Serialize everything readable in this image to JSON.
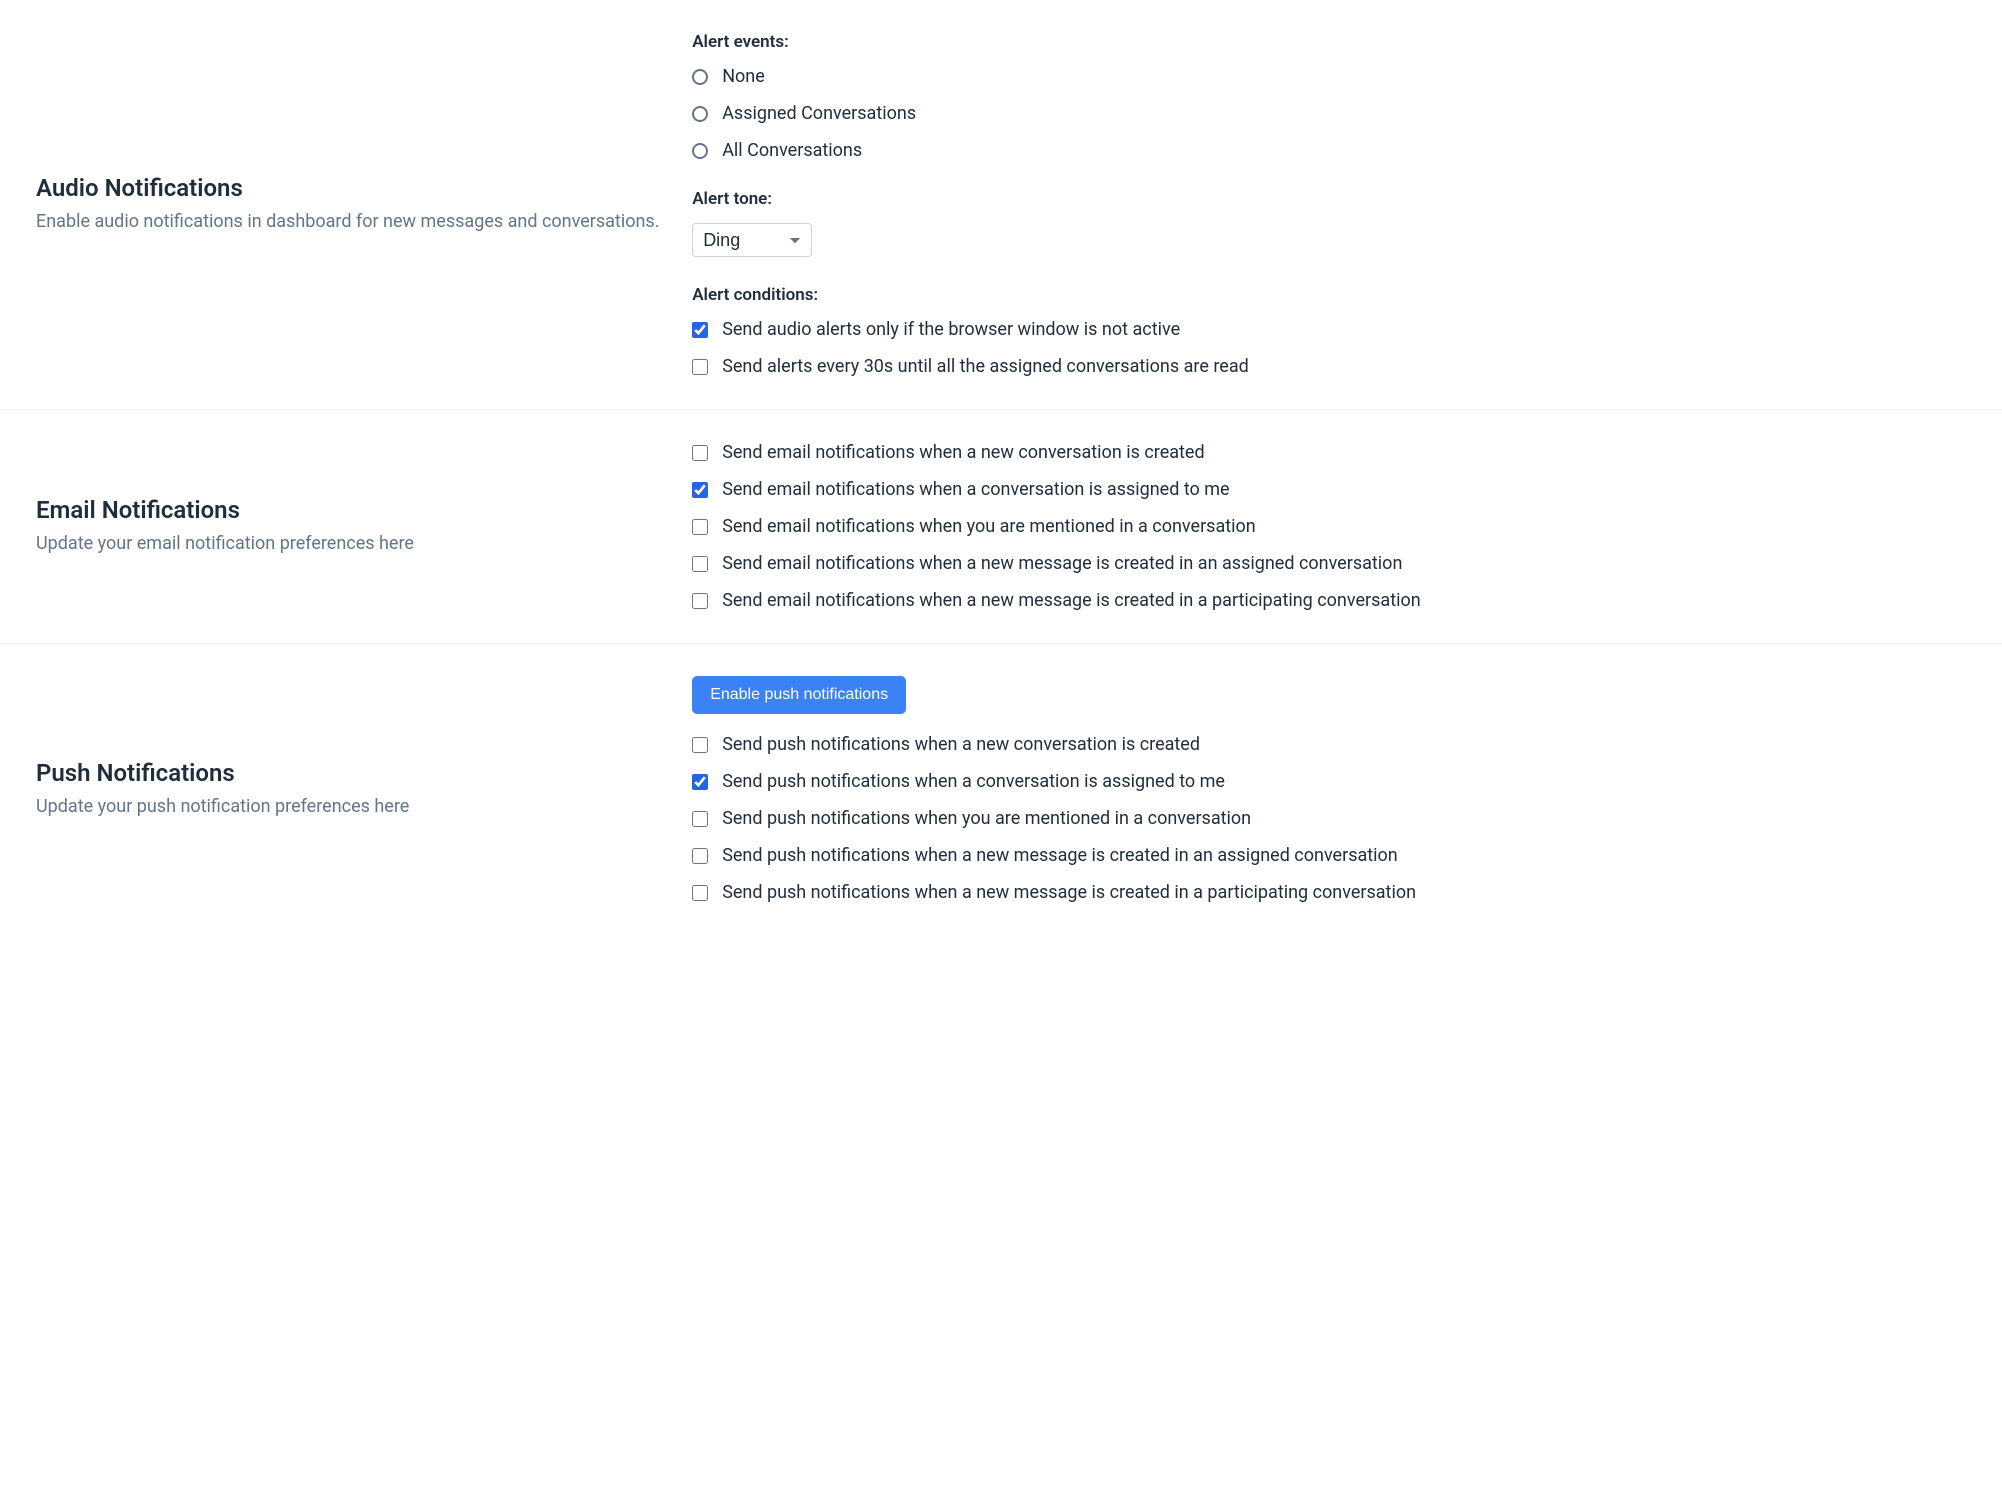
{
  "audio": {
    "title": "Audio Notifications",
    "desc": "Enable audio notifications in dashboard for new messages and conversations.",
    "events_label": "Alert events:",
    "events": {
      "none": "None",
      "assigned": "Assigned Conversations",
      "all": "All Conversations"
    },
    "tone_label": "Alert tone:",
    "tone_selected": "Ding",
    "conditions_label": "Alert conditions:",
    "conditions": {
      "inactive_only": "Send audio alerts only if the browser window is not active",
      "repeat_30s": "Send alerts every 30s until all the assigned conversations are read"
    }
  },
  "email": {
    "title": "Email Notifications",
    "desc": "Update your email notification preferences here",
    "opts": {
      "new_conv": "Send email notifications when a new conversation is created",
      "assigned": "Send email notifications when a conversation is assigned to me",
      "mentioned": "Send email notifications when you are mentioned in a conversation",
      "msg_assigned": "Send email notifications when a new message is created in an assigned conversation",
      "msg_participating": "Send email notifications when a new message is created in a participating conversation"
    }
  },
  "push": {
    "title": "Push Notifications",
    "desc": "Update your push notification preferences here",
    "enable_button": "Enable push notifications",
    "opts": {
      "new_conv": "Send push notifications when a new conversation is created",
      "assigned": "Send push notifications when a conversation is assigned to me",
      "mentioned": "Send push notifications when you are mentioned in a conversation",
      "msg_assigned": "Send push notifications when a new message is created in an assigned conversation",
      "msg_participating": "Send push notifications when a new message is created in a participating conversation"
    }
  }
}
